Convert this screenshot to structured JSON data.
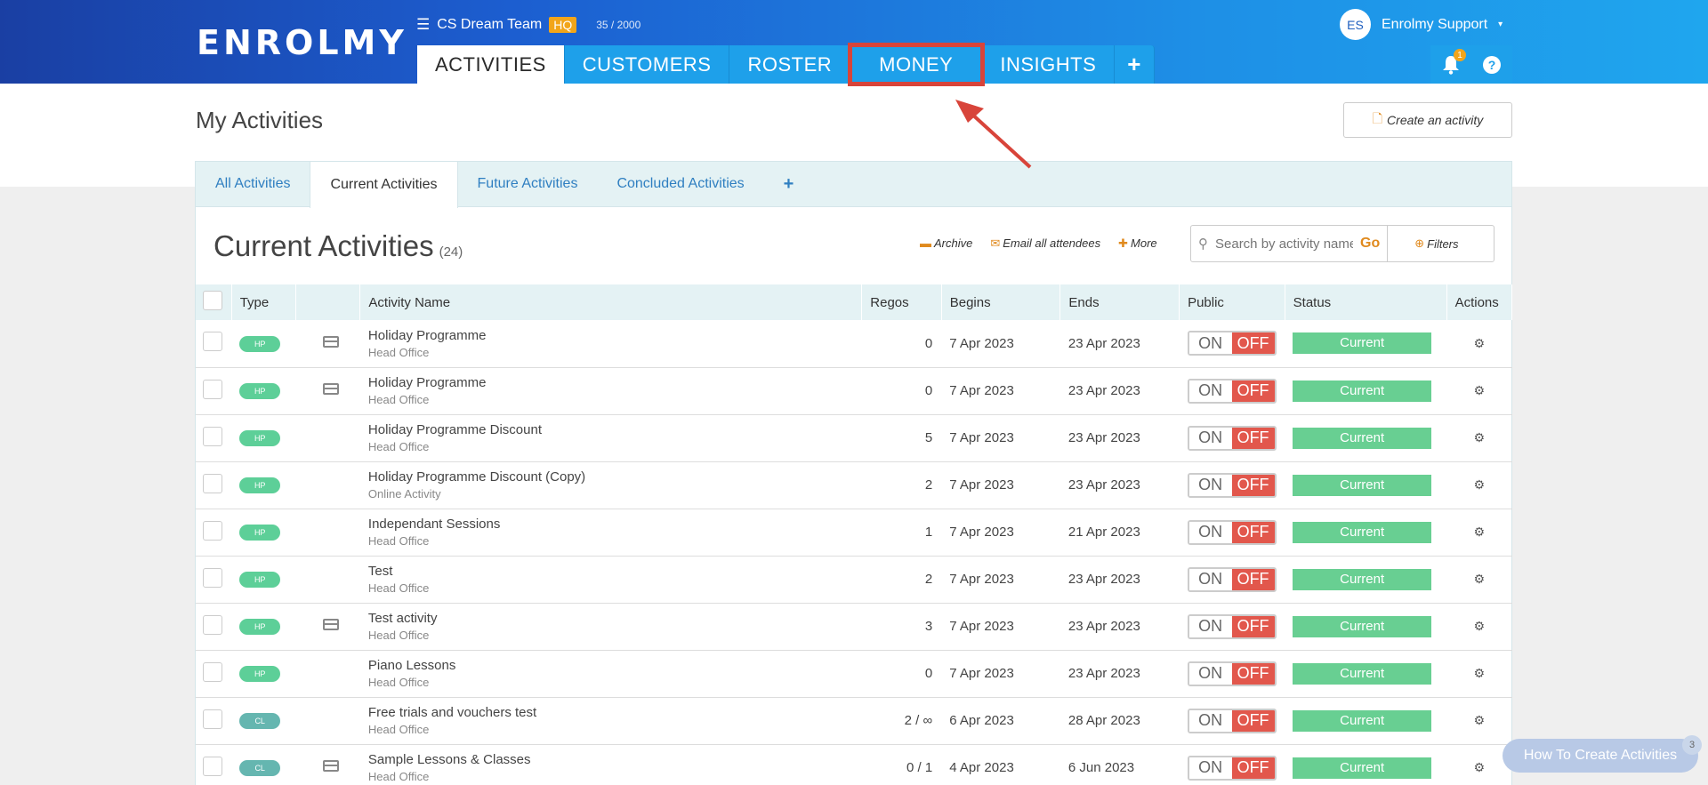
{
  "brand": {
    "logo": "ENROLMY"
  },
  "header": {
    "team_name": "CS Dream Team",
    "hq_badge": "HQ",
    "usage": "35 / 2000",
    "avatar_initials": "ES",
    "user_name": "Enrolmy Support",
    "notification_count": "1"
  },
  "nav": {
    "tabs": [
      {
        "label": "ACTIVITIES"
      },
      {
        "label": "CUSTOMERS"
      },
      {
        "label": "ROSTER"
      },
      {
        "label": "MONEY"
      },
      {
        "label": "INSIGHTS"
      },
      {
        "label": "+"
      }
    ]
  },
  "page": {
    "title": "My Activities",
    "create_button": "Create an activity"
  },
  "subtabs": [
    {
      "label": "All Activities"
    },
    {
      "label": "Current Activities"
    },
    {
      "label": "Future Activities"
    },
    {
      "label": "Concluded Activities"
    },
    {
      "label": "+"
    }
  ],
  "list": {
    "title": "Current Activities",
    "count": "(24)",
    "archive": "Archive",
    "email_all": "Email all attendees",
    "more": "More",
    "search_placeholder": "Search by activity name",
    "go": "Go",
    "filters": "Filters"
  },
  "table": {
    "columns": [
      "Type",
      "",
      "Activity Name",
      "Regos",
      "Begins",
      "Ends",
      "Public",
      "Status",
      "Actions"
    ],
    "toggle_on": "ON",
    "toggle_off": "OFF",
    "rows": [
      {
        "type": "HP",
        "card": true,
        "name": "Holiday Programme",
        "location": "Head Office",
        "regos": "0",
        "begins": "7 Apr 2023",
        "ends": "23 Apr 2023",
        "status": "Current"
      },
      {
        "type": "HP",
        "card": true,
        "name": "Holiday Programme",
        "location": "Head Office",
        "regos": "0",
        "begins": "7 Apr 2023",
        "ends": "23 Apr 2023",
        "status": "Current"
      },
      {
        "type": "HP",
        "card": false,
        "name": "Holiday Programme Discount",
        "location": "Head Office",
        "regos": "5",
        "begins": "7 Apr 2023",
        "ends": "23 Apr 2023",
        "status": "Current"
      },
      {
        "type": "HP",
        "card": false,
        "name": "Holiday Programme Discount (Copy)",
        "location": "Online Activity",
        "regos": "2",
        "begins": "7 Apr 2023",
        "ends": "23 Apr 2023",
        "status": "Current"
      },
      {
        "type": "HP",
        "card": false,
        "name": "Independant Sessions",
        "location": "Head Office",
        "regos": "1",
        "begins": "7 Apr 2023",
        "ends": "21 Apr 2023",
        "status": "Current"
      },
      {
        "type": "HP",
        "card": false,
        "name": "Test",
        "location": "Head Office",
        "regos": "2",
        "begins": "7 Apr 2023",
        "ends": "23 Apr 2023",
        "status": "Current"
      },
      {
        "type": "HP",
        "card": true,
        "name": "Test activity",
        "location": "Head Office",
        "regos": "3",
        "begins": "7 Apr 2023",
        "ends": "23 Apr 2023",
        "status": "Current"
      },
      {
        "type": "HP",
        "card": false,
        "name": "Piano Lessons",
        "location": "Head Office",
        "regos": "0",
        "begins": "7 Apr 2023",
        "ends": "23 Apr 2023",
        "status": "Current"
      },
      {
        "type": "CL",
        "card": false,
        "name": "Free trials and vouchers test",
        "location": "Head Office",
        "regos": "2 / ∞",
        "begins": "6 Apr 2023",
        "ends": "28 Apr 2023",
        "status": "Current"
      },
      {
        "type": "CL",
        "card": true,
        "name": "Sample Lessons & Classes",
        "location": "Head Office",
        "regos": "0 / 1",
        "begins": "4 Apr 2023",
        "ends": "6 Jun 2023",
        "status": "Current"
      }
    ]
  },
  "help_widget": {
    "label": "How To Create Activities",
    "count": "3"
  },
  "colors": {
    "accent": "#1ea0ea",
    "highlight": "#d8443a",
    "status_current": "#68cf92",
    "toggle_off": "#e2574c"
  }
}
